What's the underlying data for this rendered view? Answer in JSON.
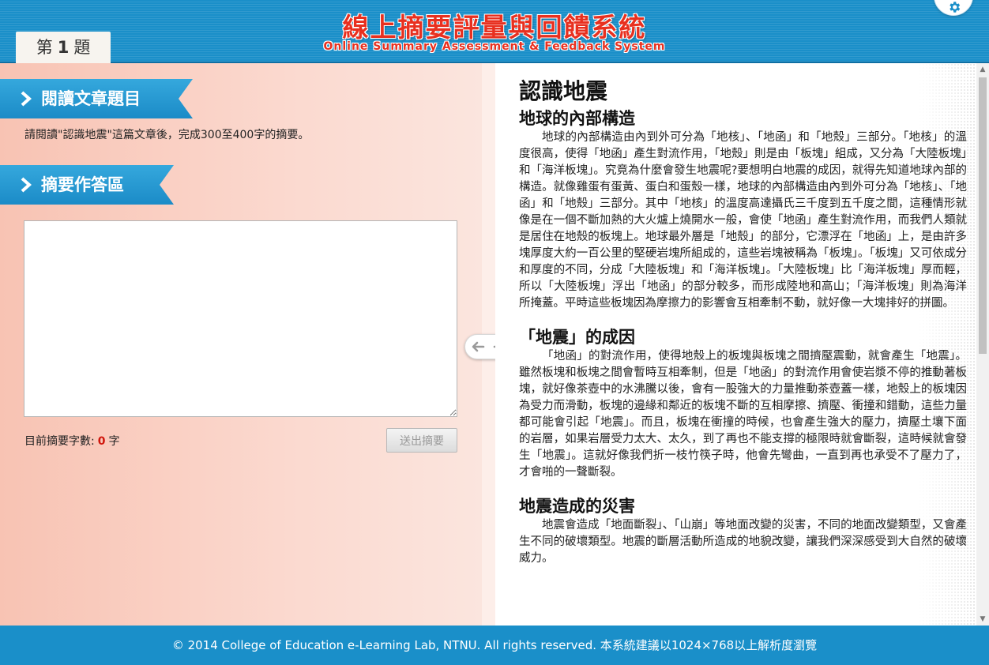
{
  "header": {
    "title_zh": "線上摘要評量與回饋系統",
    "title_en": "Online Summary Assessment & Feedback System",
    "question_prefix": "第",
    "question_number": "1",
    "question_suffix": "題",
    "settings_icon": "gear-icon"
  },
  "left": {
    "section1_title": "閱讀文章題目",
    "instruction": "請閱讀\"認識地震\"這篇文章後，完成300至400字的摘要。",
    "section2_title": "摘要作答區",
    "answer_value": "",
    "count_label": "目前摘要字數:",
    "count_value": "0",
    "count_unit": "字",
    "submit_label": "送出摘要"
  },
  "article": {
    "title": "認識地震",
    "sections": [
      {
        "heading": "地球的內部構造",
        "body": "地球的內部構造由內到外可分為「地核」、「地函」和「地殼」三部分。「地核」的溫度很高，使得「地函」產生對流作用，「地殼」則是由「板塊」組成，又分為「大陸板塊」和「海洋板塊」。究竟為什麼會發生地震呢?要想明白地震的成因，就得先知道地球內部的構造。就像雞蛋有蛋黃、蛋白和蛋殼一樣，地球的內部構造由內到外可分為「地核」、「地函」和「地殼」三部分。其中「地核」的溫度高達攝氏三千度到五千度之間，這種情形就像是在一個不斷加熱的大火爐上燒開水一般，會使「地函」產生對流作用，而我們人類就是居住在地殼的板塊上。地球最外層是「地殼」的部分，它漂浮在「地函」上，是由許多塊厚度大約一百公里的堅硬岩塊所組成的，這些岩塊被稱為「板塊」。「板塊」又可依成分和厚度的不同，分成「大陸板塊」和「海洋板塊」。「大陸板塊」比「海洋板塊」厚而輕，所以「大陸板塊」浮出「地函」的部分較多，而形成陸地和高山；「海洋板塊」則為海洋所掩蓋。平時這些板塊因為摩擦力的影響會互相牽制不動，就好像一大塊排好的拼圖。"
      },
      {
        "heading": "「地震」的成因",
        "body": "「地函」的對流作用，使得地殼上的板塊與板塊之間擠壓震動，就會產生「地震」。雖然板塊和板塊之間會暫時互相牽制，但是「地函」的對流作用會使岩漿不停的推動著板塊，就好像茶壺中的水沸騰以後，會有一股強大的力量推動茶壺蓋一樣，地殼上的板塊因為受力而滑動，板塊的邊緣和鄰近的板塊不斷的互相摩擦、擠壓、衝撞和錯動，這些力量都可能會引起「地震」。而且，板塊在衝撞的時候，也會產生強大的壓力，擠壓土壤下面的岩層，如果岩層受力太大、太久，到了再也不能支撐的極限時就會斷裂，這時候就會發生「地震」。這就好像我們折一枝竹筷子時，他會先彎曲，一直到再也承受不了壓力了，才會啪的一聲斷裂。"
      },
      {
        "heading": "地震造成的災害",
        "body": "地震會造成「地面斷裂」、「山崩」等地面改變的災害，不同的地面改變類型，又會產生不同的破壞類型。地震的斷層活動所造成的地貌改變，讓我們深深感受到大自然的破壞威力。"
      }
    ]
  },
  "footer": {
    "text": "© 2014 College of Education e-Learning Lab, NTNU. All rights reserved. 本系統建議以1024×768以上解析度瀏覽"
  },
  "colors": {
    "header_blue": "#1a8fc9",
    "title_red": "#e8301f",
    "count_red": "#d0160c",
    "left_bg": "#f8c3b3"
  }
}
